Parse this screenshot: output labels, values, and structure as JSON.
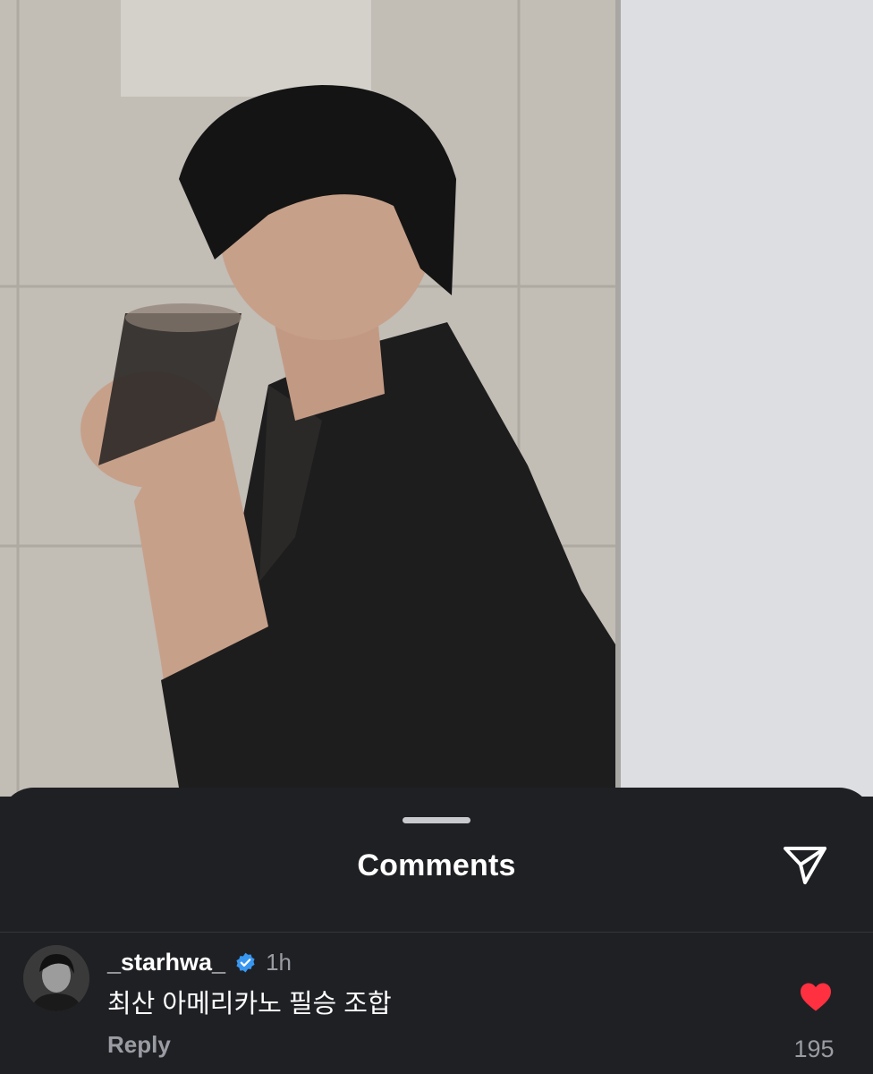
{
  "sheet": {
    "title": "Comments",
    "share_icon": "send-icon"
  },
  "comment": {
    "username": "_starhwa_",
    "verified_icon": "verified-badge-icon",
    "time": "1h",
    "text": "최산 아메리카노 필승 조합",
    "reply_label": "Reply",
    "like_icon": "heart-icon",
    "like_count": "195"
  },
  "colors": {
    "sheet_background": "#1f2024",
    "like_red": "#ff3040",
    "verified_blue": "#3897f0",
    "muted_text": "#9a9ca3"
  }
}
